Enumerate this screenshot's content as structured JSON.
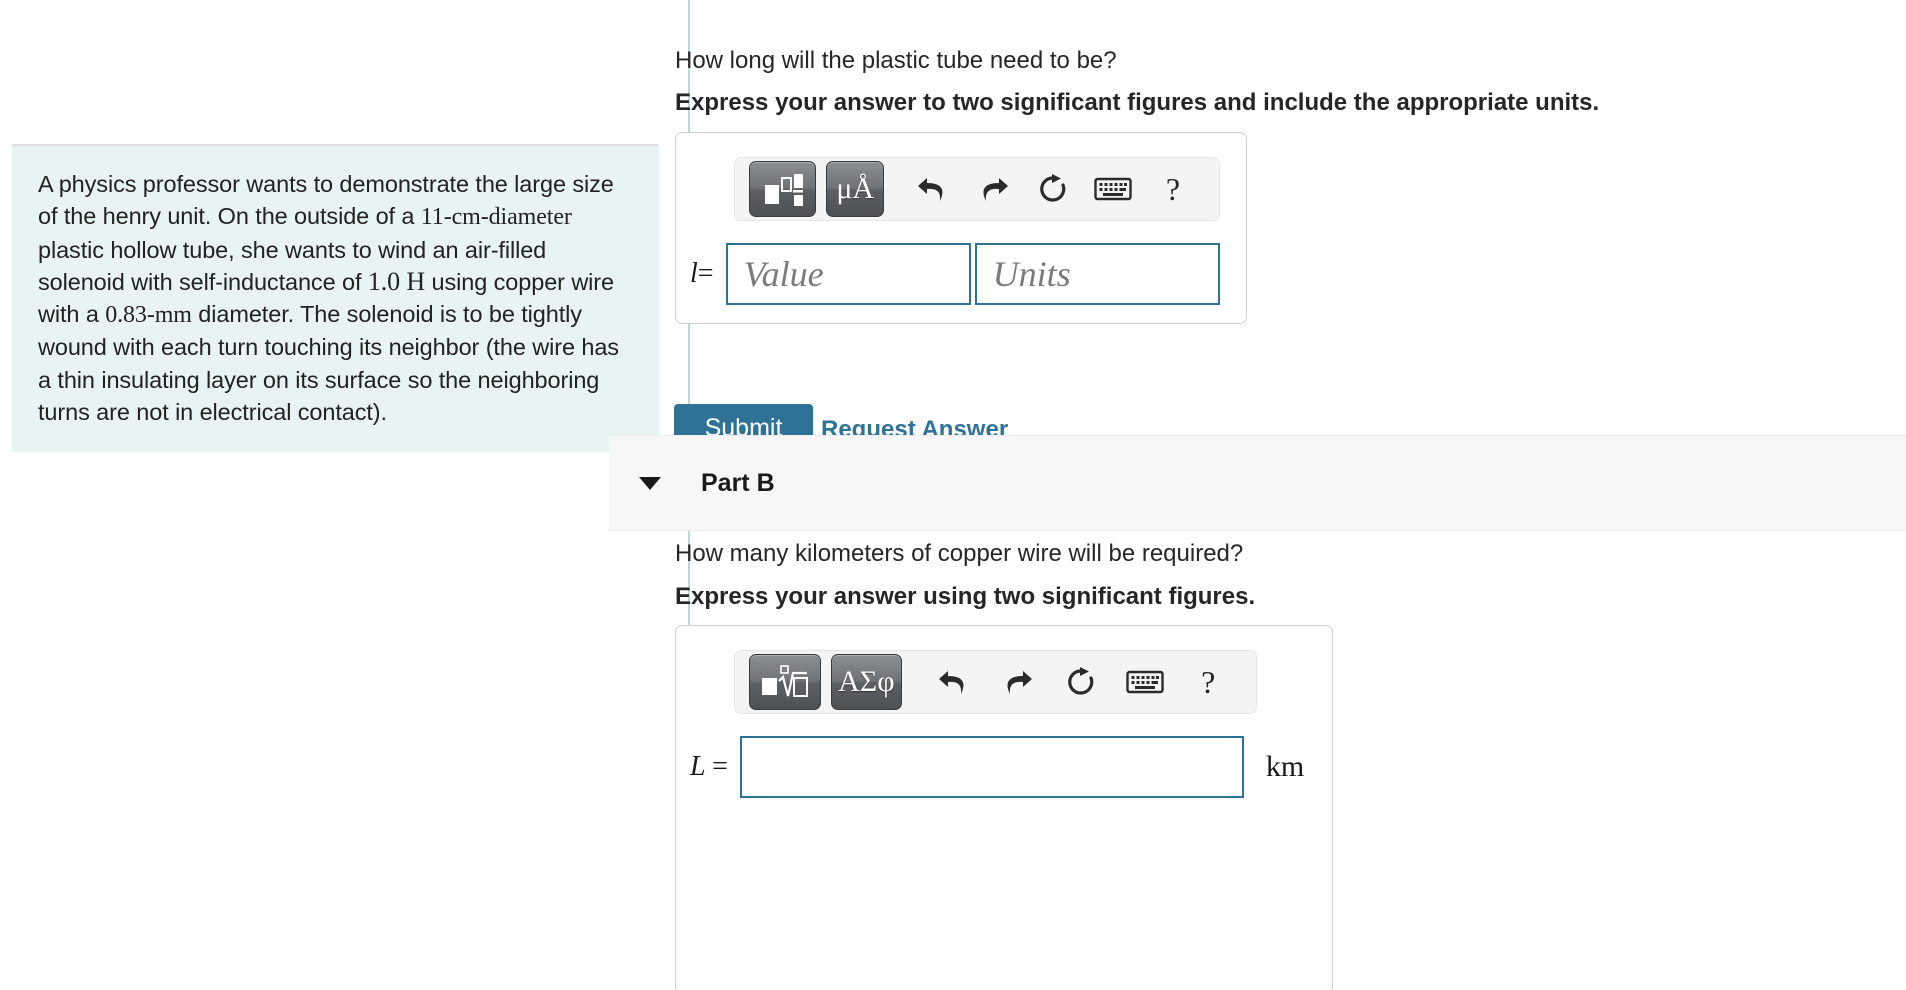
{
  "problem": {
    "statement_parts": [
      {
        "text": "A physics professor wants to demonstrate the large size of the henry unit. On the outside of a ",
        "style": "normal"
      },
      {
        "text": "11-cm-diameter",
        "style": "serif"
      },
      {
        "text": " plastic hollow tube, she wants to wind an air-filled solenoid with self-inductance of ",
        "style": "normal"
      },
      {
        "text": "1.0 H",
        "style": "serif-unit"
      },
      {
        "text": " using copper wire with a ",
        "style": "normal"
      },
      {
        "text": "0.83-mm",
        "style": "serif"
      },
      {
        "text": " diameter. The solenoid is to be tightly wound with each turn touching its neighbor (the wire has a thin insulating layer on its surface so the neighboring turns are not in electrical contact).",
        "style": "normal"
      }
    ],
    "statement_plain": "A physics professor wants to demonstrate the large size of the henry unit. On the outside of a 11-cm-diameter plastic hollow tube, she wants to wind an air-filled solenoid with self-inductance of 1.0 H using copper wire with a 0.83-mm diameter. The solenoid is to be tightly wound with each turn touching its neighbor (the wire has a thin insulating layer on its surface so the neighboring turns are not in electrical contact)."
  },
  "part_a": {
    "question": "How long will the plastic tube need to be?",
    "instruction": "Express your answer to two significant figures and include the appropriate units.",
    "toolbar": {
      "template_button_label": "math-template",
      "units_button_label": "μÅ",
      "undo_label": "undo",
      "redo_label": "redo",
      "reset_label": "reset",
      "keyboard_label": "keyboard",
      "help_label": "?"
    },
    "equation_label": "l",
    "equation_sign": "=",
    "value_placeholder": "Value",
    "units_placeholder": "Units",
    "value_current": "",
    "units_current": "",
    "submit_label": "Submit",
    "request_answer_label": "Request Answer"
  },
  "part_b": {
    "header_title": "Part B",
    "collapsed": false,
    "question": "How many kilometers of copper wire will be required?",
    "instruction": "Express your answer using two significant figures.",
    "toolbar": {
      "template_button_label": "sqrt-template",
      "greek_button_label": "ΑΣφ",
      "undo_label": "undo",
      "redo_label": "redo",
      "reset_label": "reset",
      "keyboard_label": "keyboard",
      "help_label": "?"
    },
    "equation_label": "L",
    "equation_sign": "=",
    "value_current": "",
    "unit_suffix": "km"
  },
  "colors": {
    "accent": "#2e7396",
    "problem_box_bg": "#e8f4f4",
    "divider": "#c3d3de",
    "part_header_bg": "#f7f7f7",
    "toolbar_bg": "#f4f4f4"
  }
}
